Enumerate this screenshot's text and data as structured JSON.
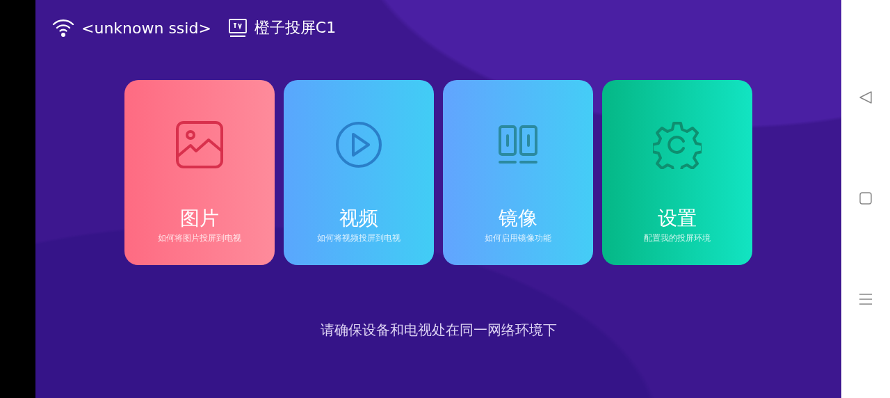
{
  "header": {
    "network": "<unknown ssid>",
    "device": "橙子投屏C1"
  },
  "cards": [
    {
      "kind": "picture",
      "title": "图片",
      "subtitle": "如何将图片投屏到电视"
    },
    {
      "kind": "video",
      "title": "视频",
      "subtitle": "如何将视频投屏到电视"
    },
    {
      "kind": "mirror",
      "title": "镜像",
      "subtitle": "如何启用镜像功能"
    },
    {
      "kind": "settings",
      "title": "设置",
      "subtitle": "配置我的投屏环境"
    }
  ],
  "hint": "请确保设备和电视处在同一网络环境下"
}
